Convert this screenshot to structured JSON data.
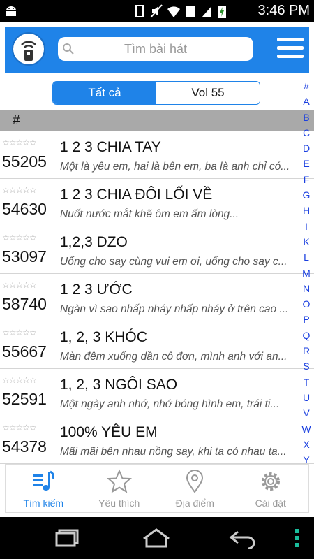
{
  "status_bar": {
    "time": "3:46 PM"
  },
  "search": {
    "placeholder": "Tìm bài hát"
  },
  "segments": {
    "all": "Tất cả",
    "vol": "Vol 55"
  },
  "section_header": "#",
  "alphabet": [
    "#",
    "A",
    "B",
    "C",
    "D",
    "E",
    "F",
    "G",
    "H",
    "I",
    "K",
    "L",
    "M",
    "N",
    "O",
    "P",
    "Q",
    "R",
    "S",
    "T",
    "U",
    "V",
    "W",
    "X",
    "Y"
  ],
  "songs": [
    {
      "stars": "☆☆☆☆☆",
      "code": "55205",
      "title": "1 2 3 CHIA TAY",
      "lyric": "Một là yêu em, hai là bên em, ba là anh chỉ có..."
    },
    {
      "stars": "☆☆☆☆☆",
      "code": "54630",
      "title": "1 2 3 CHIA ĐÔI LỐI VỀ",
      "lyric": "Nuốt nước mắt khẽ ôm em ấm lòng..."
    },
    {
      "stars": "☆☆☆☆☆",
      "code": "53097",
      "title": "1,2,3 DZO",
      "lyric": "Uống cho say cùng vui em ơi, uống cho say c..."
    },
    {
      "stars": "☆☆☆☆☆",
      "code": "58740",
      "title": "1 2 3 ƯỚC",
      "lyric": "Ngàn vì sao nhấp nháy nhấp nháy ở trên cao ..."
    },
    {
      "stars": "☆☆☆☆☆",
      "code": "55667",
      "title": "1, 2, 3 KHÓC",
      "lyric": "Màn đêm xuống dần cô đơn, mình anh với an..."
    },
    {
      "stars": "☆☆☆☆☆",
      "code": "52591",
      "title": "1, 2, 3 NGÔI SAO",
      "lyric": "Một ngày anh nhớ, nhớ bóng hình em, trái ti..."
    },
    {
      "stars": "☆☆☆☆☆",
      "code": "54378",
      "title": "100% YÊU EM",
      "lyric": "Mãi mãi bên nhau nồng say, khi ta có nhau ta..."
    }
  ],
  "tabs": [
    {
      "label": "Tìm kiếm",
      "icon": "music-list-icon",
      "active": true
    },
    {
      "label": "Yêu thích",
      "icon": "star-icon",
      "active": false
    },
    {
      "label": "Địa điểm",
      "icon": "location-pin-icon",
      "active": false
    },
    {
      "label": "Cài đặt",
      "icon": "gear-icon",
      "active": false
    }
  ],
  "colors": {
    "accent": "#1f83e8",
    "index_letters": "#1a3fe0",
    "section_bg": "#a9a9a9"
  }
}
